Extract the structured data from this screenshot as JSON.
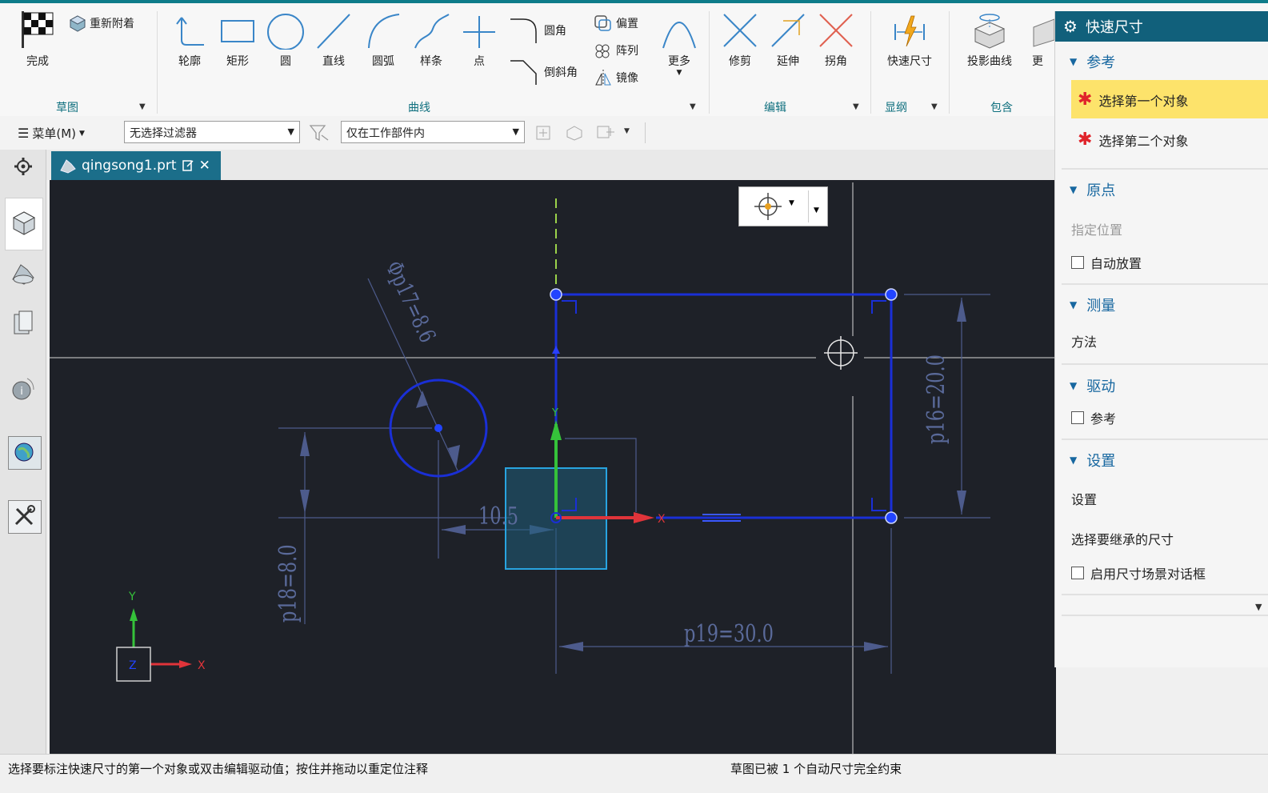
{
  "ribbon": {
    "finish": "完成",
    "reattach": "重新附着",
    "profile": "轮廓",
    "rectangle": "矩形",
    "circle": "圆",
    "line": "直线",
    "arc": "圆弧",
    "spline": "样条",
    "point": "点",
    "fillet": "圆角",
    "chamfer": "倒斜角",
    "offset": "偏置",
    "pattern": "阵列",
    "mirror": "镜像",
    "more_curves": "更多",
    "trim": "修剪",
    "extend": "延伸",
    "corner": "拐角",
    "rapid_dimension": "快速尺寸",
    "project_curve": "投影曲线",
    "more_truncated": "更",
    "groups": {
      "sketch": "草图",
      "curve": "曲线",
      "edit": "编辑",
      "dimension": "显纲",
      "include": "包含"
    }
  },
  "toolbar": {
    "menu": "菜单(M)",
    "filter": "无选择过滤器",
    "scope": "仅在工作部件内"
  },
  "tab": {
    "filename": "qingsong1.prt"
  },
  "canvas": {
    "dim_diameter": "Φp17=8.6",
    "dim_height": "p16=20.0",
    "dim_width": "p19=30.0",
    "dim_left": "p18=8.0",
    "dim_live": "10.5",
    "axis_x": "X",
    "axis_y": "Y",
    "triad_x": "X",
    "triad_y": "Y",
    "triad_z": "Z"
  },
  "panel": {
    "title": "快速尺寸",
    "section_reference": "参考",
    "select_first": "选择第一个对象",
    "select_second": "选择第二个对象",
    "section_origin": "原点",
    "specify_location": "指定位置",
    "auto_place": "自动放置",
    "section_measure": "测量",
    "method": "方法",
    "section_driving": "驱动",
    "reference": "参考",
    "section_settings": "设置",
    "settings": "设置",
    "inherit": "选择要继承的尺寸",
    "enable_dialog": "启用尺寸场景对话框"
  },
  "status": {
    "left": "选择要标注快速尺寸的第一个对象或双击编辑驱动值；按住并拖动以重定位注释",
    "right": "草图已被 1 个自动尺寸完全约束"
  },
  "colors": {
    "accent": "#11607b",
    "canvas_bg": "#1e2128",
    "sketch_blue": "#1a2fd6",
    "dim_color": "#5a6a9a",
    "highlight": "#fde36b"
  }
}
